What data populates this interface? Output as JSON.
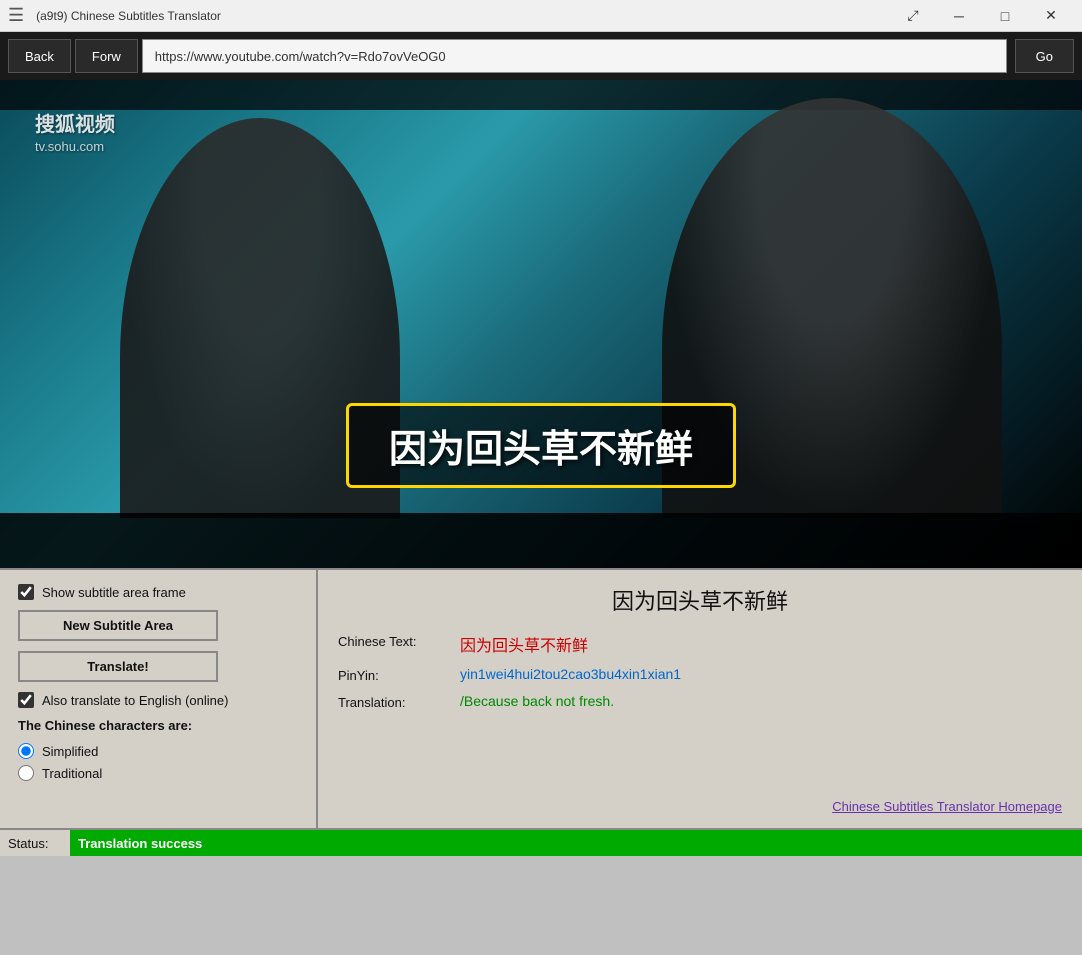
{
  "titlebar": {
    "title": "(a9t9) Chinese Subtitles Translator",
    "menu_icon": "☰",
    "minimize_icon": "─",
    "maximize_icon": "□",
    "close_icon": "✕"
  },
  "navbar": {
    "back_label": "Back",
    "forward_label": "Forw",
    "url": "https://www.youtube.com/watch?v=Rdo7ovVeOG0",
    "go_label": "Go"
  },
  "video": {
    "watermark_line1": "搜狐视频",
    "watermark_line2": "tv.sohu.com",
    "subtitle_chinese": "因为回头草不新鲜"
  },
  "controls": {
    "show_subtitle_frame_label": "Show subtitle area frame",
    "new_subtitle_area_label": "New Subtitle Area",
    "translate_label": "Translate!",
    "also_translate_label": "Also translate to English (online)",
    "char_type_label": "The Chinese characters are:",
    "simplified_label": "Simplified",
    "traditional_label": "Traditional"
  },
  "results": {
    "title": "因为回头草不新鲜",
    "chinese_label": "Chinese Text:",
    "chinese_value": "因为回头草不新鲜",
    "pinyin_label": "PinYin:",
    "pinyin_value": "yin1wei4hui2tou2cao3bu4xin1xian1",
    "translation_label": "Translation:",
    "translation_value": "/Because back not fresh.",
    "homepage_link": "Chinese Subtitles Translator Homepage"
  },
  "status": {
    "label": "Status:",
    "value": "Translation success"
  }
}
